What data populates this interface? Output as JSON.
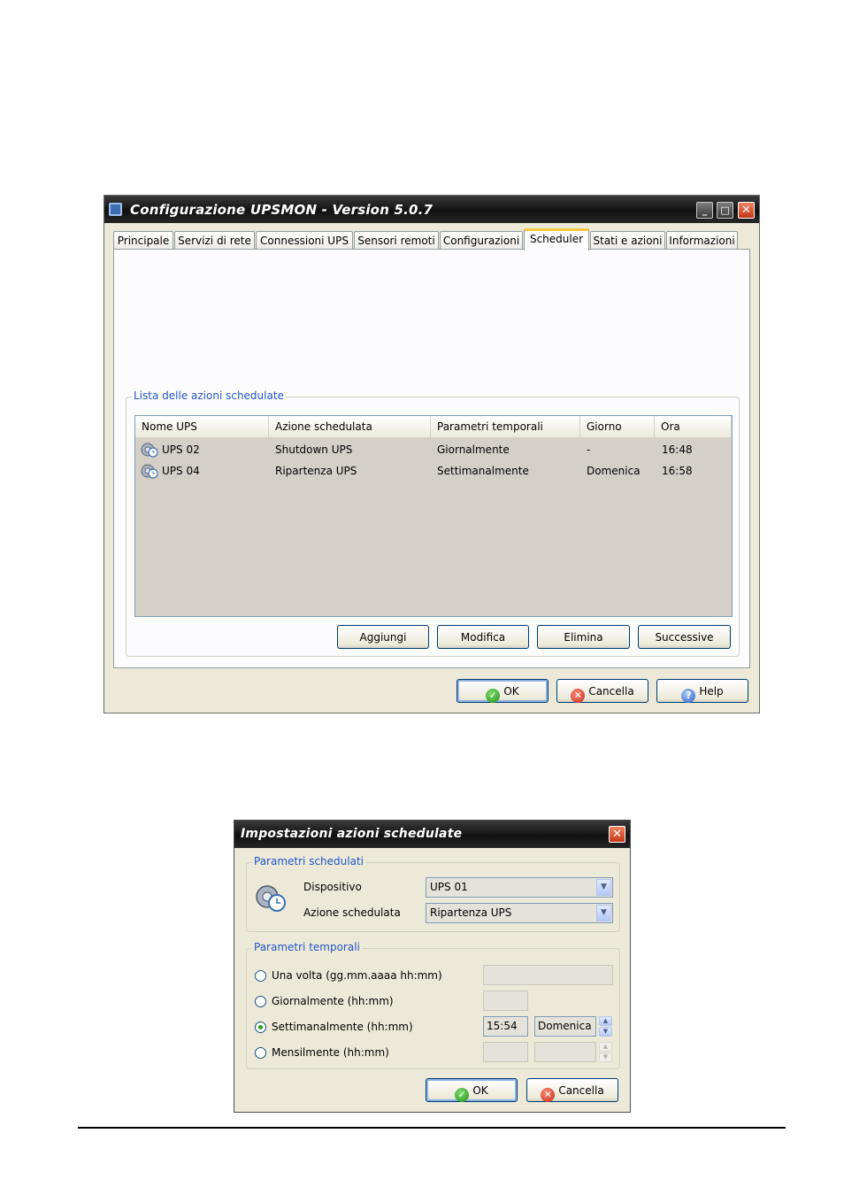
{
  "main_window": {
    "title": "Configurazione UPSMON - Version 5.0.7",
    "tabs": [
      "Principale",
      "Servizi di rete",
      "Connessioni UPS",
      "Sensori remoti",
      "Configurazioni",
      "Scheduler",
      "Stati e azioni",
      "Informazioni"
    ],
    "active_tab": "Scheduler",
    "group_label": "Lista delle azioni schedulate",
    "columns": [
      "Nome UPS",
      "Azione schedulata",
      "Parametri temporali",
      "Giorno",
      "Ora"
    ],
    "rows": [
      {
        "icon": "gear-clock-icon",
        "name": "UPS 02",
        "action": "Shutdown UPS",
        "params": "Giornalmente",
        "day": "-",
        "time": "16:48"
      },
      {
        "icon": "gear-clock-icon",
        "name": "UPS 04",
        "action": "Ripartenza UPS",
        "params": "Settimanalmente",
        "day": "Domenica",
        "time": "16:58"
      }
    ],
    "list_buttons": {
      "add": "Aggiungi",
      "edit": "Modifica",
      "delete": "Elimina",
      "next": "Successive"
    },
    "footer_buttons": {
      "ok": "OK",
      "cancel": "Cancella",
      "help": "Help"
    }
  },
  "dialog": {
    "title": "Impostazioni azioni schedulate",
    "group1_label": "Parametri schedulati",
    "device_label": "Dispositivo",
    "device_value": "UPS 01",
    "action_label": "Azione schedulata",
    "action_value": "Ripartenza UPS",
    "group2_label": "Parametri temporali",
    "options": [
      {
        "label": "Una volta (gg.mm.aaaa hh:mm)",
        "checked": false
      },
      {
        "label": "Giornalmente (hh:mm)",
        "checked": false
      },
      {
        "label": "Settimanalmente (hh:mm)",
        "checked": true
      },
      {
        "label": "Mensilmente (hh:mm)",
        "checked": false
      }
    ],
    "weekly_time": "15:54",
    "weekly_day": "Domenica",
    "buttons": {
      "ok": "OK",
      "cancel": "Cancella"
    }
  },
  "colors": {
    "group_label": "#2255c8",
    "titlebar": "#1a1a1a",
    "active_tab_accent": "#ffc83c"
  }
}
